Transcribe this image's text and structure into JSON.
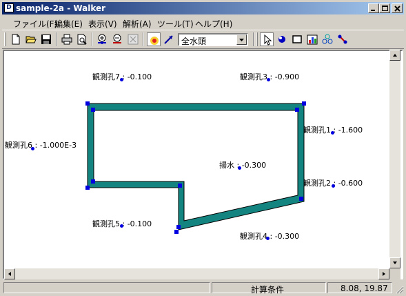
{
  "window": {
    "title": "sample-2a -  Walker",
    "app_icon_glyph": "D"
  },
  "menu": [
    "ファイル(F)",
    "編集(E)",
    "表示(V)",
    "解析(A)",
    "ツール(T)",
    "ヘルプ(H)"
  ],
  "toolbar": {
    "layer_select_value": "全水頭"
  },
  "wells": {
    "w7": {
      "label": "観測孔7 : -0.100"
    },
    "w3": {
      "label": "観測孔3 : -0.900"
    },
    "w1": {
      "label": "観測孔1 : -1.600"
    },
    "w6": {
      "label": "観測孔6 : -1.000E-3"
    },
    "pump": {
      "label": "揚水 : -0.300"
    },
    "w2": {
      "label": "観測孔2 : -0.600"
    },
    "w5": {
      "label": "観測孔5 : -0.100"
    },
    "w4": {
      "label": "観測孔4 : -0.300"
    }
  },
  "status": {
    "panel_mode": "計算条件",
    "coords": "8.08, 19.87"
  },
  "colors": {
    "boundary_fill": "#138480",
    "node": "#0000e0",
    "title_gradient_start": "#0a246a",
    "title_gradient_end": "#a6caf0"
  }
}
